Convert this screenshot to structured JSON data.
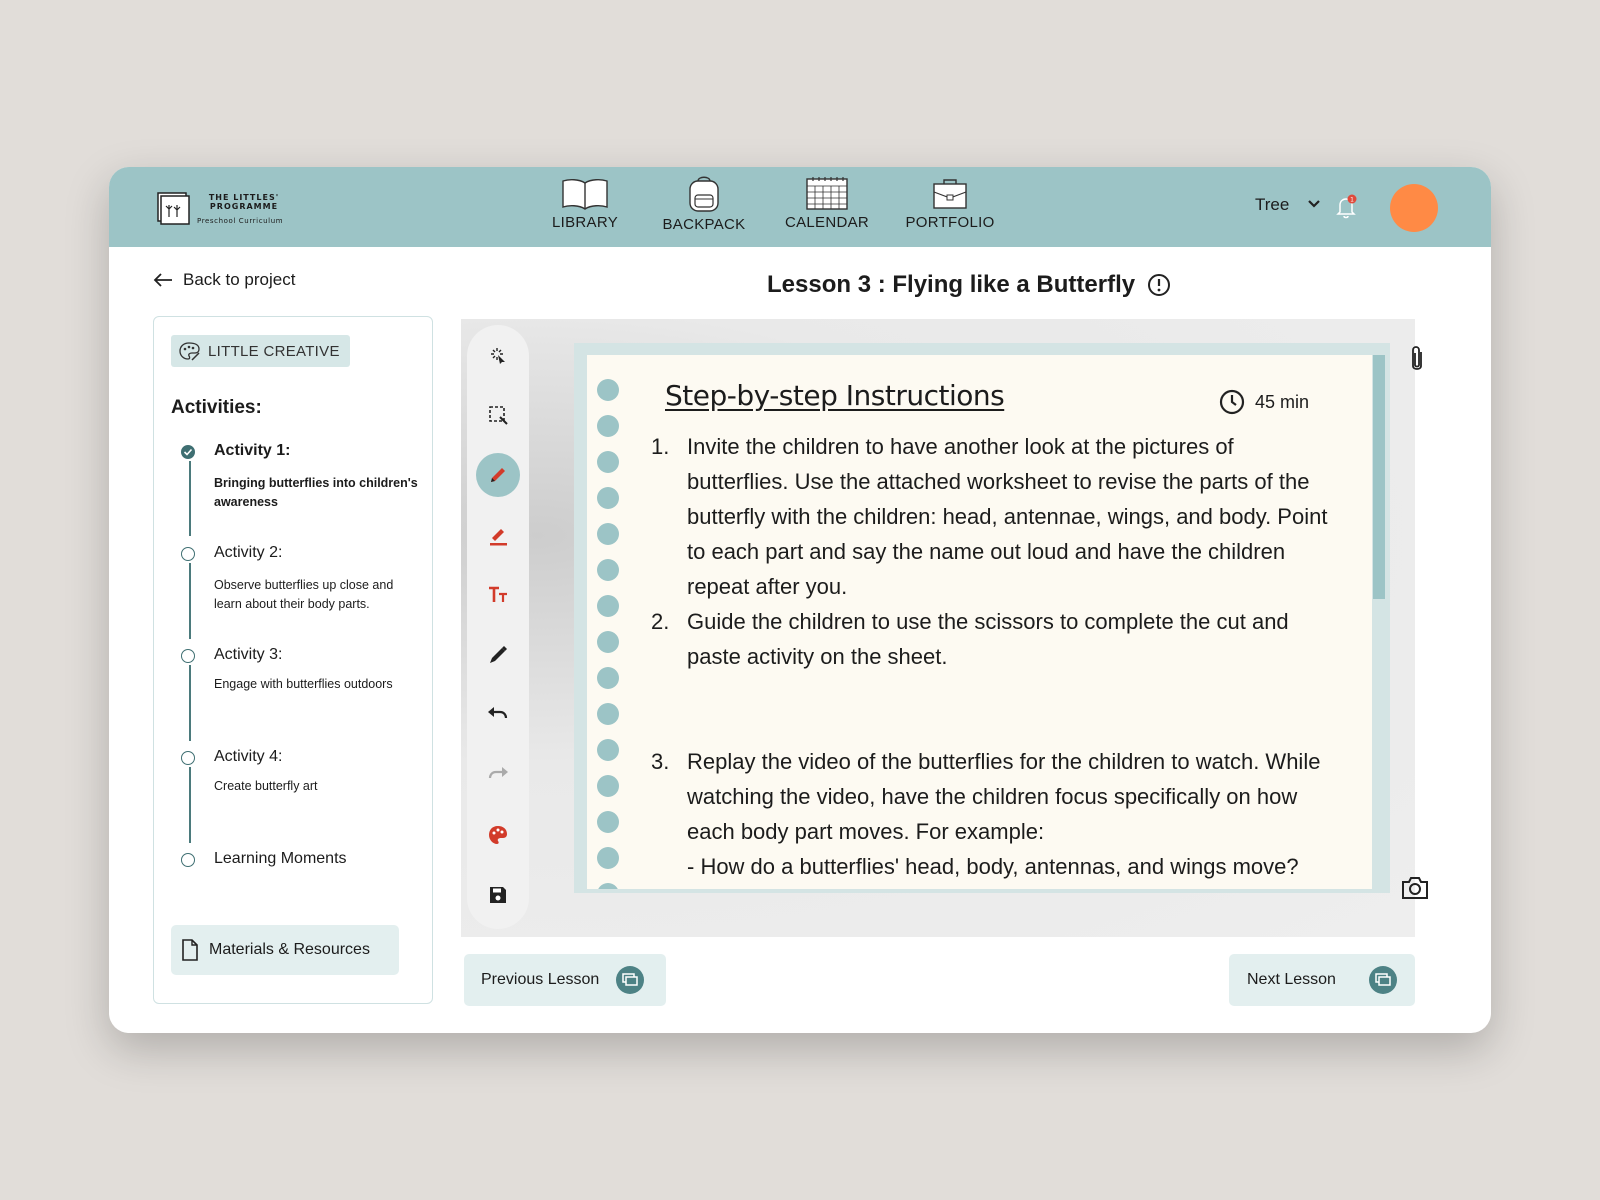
{
  "brand": {
    "line1": "THE LITTLES'",
    "line2": "PROGRAMME",
    "tagline": "Preschool Curriculum"
  },
  "nav": [
    {
      "label": "LIBRARY",
      "icon": "book-icon"
    },
    {
      "label": "BACKPACK",
      "icon": "backpack-icon"
    },
    {
      "label": "CALENDAR",
      "icon": "calendar-icon"
    },
    {
      "label": "PORTFOLIO",
      "icon": "briefcase-icon"
    }
  ],
  "user": {
    "name": "Tree",
    "notification_count": "1"
  },
  "back_link": "Back to project",
  "lesson": {
    "title": "Lesson 3 : Flying like a Butterfly"
  },
  "sidebar": {
    "badge": "LITTLE CREATIVE",
    "heading": "Activities:",
    "activities": [
      {
        "title": "Activity 1:",
        "desc": "Bringing butterflies into children's awareness",
        "done": true
      },
      {
        "title": "Activity 2:",
        "desc": "Observe butterflies up close and learn about their body parts.",
        "done": false
      },
      {
        "title": "Activity 3:",
        "desc": "Engage with butterflies outdoors",
        "done": false
      },
      {
        "title": "Activity 4:",
        "desc": "Create butterfly art",
        "done": false
      },
      {
        "title": "Learning Moments",
        "desc": "",
        "done": false
      }
    ],
    "materials": "Materials & Resources"
  },
  "tools": [
    "magic-select-icon",
    "marquee-select-icon",
    "pencil-icon",
    "highlighter-icon",
    "text-size-icon",
    "marker-icon",
    "undo-icon",
    "redo-icon",
    "palette-icon",
    "save-icon"
  ],
  "instructions": {
    "title": "Step-by-step Instructions",
    "duration": "45 min",
    "steps": [
      {
        "num": "1.",
        "text": "Invite the children to have another look at the pictures of butterflies. Use the attached worksheet to revise the parts of the butterfly with the children: head, antennae, wings, and body. Point to each part and say the name out loud and have the children repeat after you."
      },
      {
        "num": "2.",
        "text": "Guide the children to use the scissors to complete the cut and paste activity on the sheet."
      },
      {
        "num": "3.",
        "text": "Replay the video of the butterflies for the children to watch. While watching the video, have the children focus specifically on how each body part moves. For example:"
      },
      {
        "num": "",
        "text": "- How do a butterflies' head, body, antennas, and wings move?"
      }
    ]
  },
  "footer": {
    "prev": "Previous Lesson",
    "next": "Next Lesson"
  },
  "colors": {
    "accent": "#9cc4c6",
    "dark_teal": "#3f6f72",
    "avatar": "#ff8a45",
    "tool_red": "#d23b2a",
    "paper": "#fdfaf2"
  }
}
